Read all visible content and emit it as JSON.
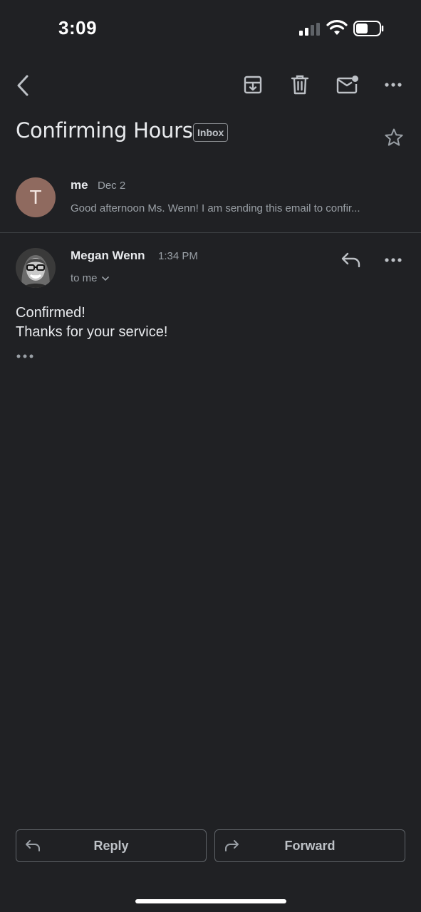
{
  "status_bar": {
    "time": "3:09"
  },
  "toolbar": {
    "back_icon": "chevron-left-icon",
    "archive_icon": "archive-icon",
    "delete_icon": "trash-icon",
    "mark_unread_icon": "mail-unread-icon",
    "more_icon": "more-horizontal-icon"
  },
  "thread": {
    "subject": "Confirming Hours",
    "label": "Inbox"
  },
  "messages": [
    {
      "avatar_letter": "T",
      "avatar_color": "#8f6a5f",
      "sender": "me",
      "date": "Dec 2",
      "snippet": "Good afternoon Ms. Wenn! I am sending this email to confir..."
    },
    {
      "sender": "Megan Wenn",
      "time": "1:34 PM",
      "recipients": "to me",
      "body_line1": "Confirmed!",
      "body_line2": "Thanks for your service!"
    }
  ],
  "actions": {
    "reply_label": "Reply",
    "forward_label": "Forward"
  },
  "colors": {
    "background": "#202124",
    "text_primary": "#e8eaed",
    "text_secondary": "#9aa0a6"
  }
}
